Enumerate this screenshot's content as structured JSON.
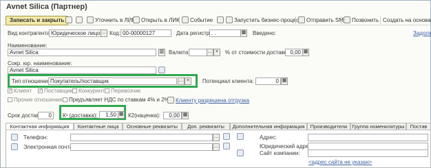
{
  "window_title": "Avnet Silica (Партнер)",
  "toolbar": {
    "save_close": "Записать и закрыть",
    "refine": "Уточнить в ЛИК",
    "open_lik": "Открыть в ЛИК",
    "event": "Событие",
    "start_process": "Запустить бизнес-процесс",
    "send_sms": "Отправить SMS",
    "call": "Позвонить",
    "create_basis": "Создать на основани"
  },
  "fields": {
    "contractor_type_label": "Вид контрагента:",
    "contractor_type_value": "Юридическое лицо",
    "code_label": "Код:",
    "code_value": "00-00000127",
    "reg_date_label": "Дата регистрации:",
    "reg_date_value": ". .",
    "introduced_label": "Введено:",
    "debt_label": "Задолж",
    "name_label": "Наименование:",
    "name_value": "Avnet Silica",
    "currency_label": "Валюта:",
    "percent_label": "% от стоимости доставки:",
    "percent_value": "0,00",
    "short_name_label": "Сокр. юр. наименование:",
    "short_name_value": "Avnet Silica",
    "relation_label": "Тип отношений:",
    "relation_value": "Покупатель/поставщик",
    "potential_label": "Потенциал клиента:",
    "potential_value": "0",
    "client_label": "Клиент",
    "supplier_label": "Поставщик",
    "competitor_label": "Конкурент",
    "carrier_label": "Перевозчик",
    "other_label": "Прочие отношения",
    "vat_label": "Предъявляет НДС по ставкам 4% и 2%",
    "shipping_link": "Клиенту разрешена отгрузка",
    "delivery_label": "Срок доставки:",
    "delivery_value": "0",
    "k1_label": "К¹ (доставка):",
    "k1_value": "1,50",
    "k2_label": "К2(наценка):",
    "k2_value": "0,00"
  },
  "tabs": [
    "Контактная информация",
    "Контактные лица",
    "Основные реквизиты",
    "Доп. реквизиты",
    "Дополнительная информация",
    "Производители",
    "Группа номенклатуры",
    "Постав"
  ],
  "contact": {
    "phone_label": "Телефон:",
    "email_label": "Электронная почта:",
    "address_label": "Адрес:",
    "legal_address_label": "Юридический адрес:",
    "site_label": "Сайт компании:",
    "site_placeholder": "<адрес сайта не указан>"
  },
  "colors": {
    "highlight": "#2fa84f",
    "accent": "#f2e9a9"
  }
}
